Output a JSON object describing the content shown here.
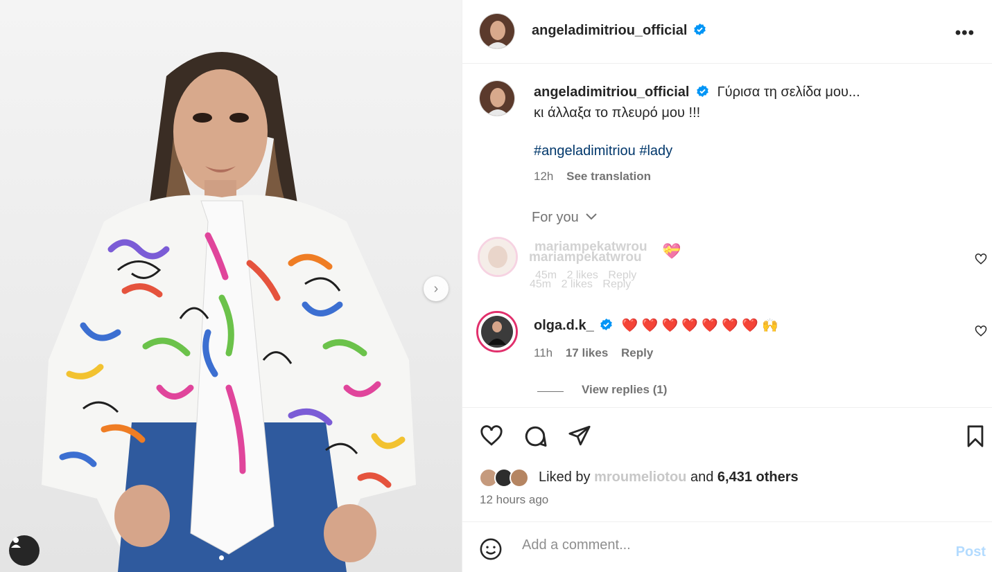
{
  "post": {
    "author": "angeladimitriou_official",
    "caption_line1": "Γύρισα τη σελίδα μου...",
    "caption_line2": "κι άλλαξα το πλευρό μου !!!",
    "hashtags": [
      "#angeladimitriou",
      "#lady"
    ],
    "posted_short": "12h",
    "see_translation": "See translation",
    "time_ago": "12 hours ago"
  },
  "comments_filter": "For you",
  "comments": [
    {
      "user": "mariampekatwrou",
      "time": "45m",
      "likes": "2 likes",
      "reply": "Reply"
    },
    {
      "user": "olga.d.k_",
      "text": "❤️ ❤️ ❤️ ❤️ ❤️ ❤️ ❤️ 🙌",
      "time": "11h",
      "likes": "17 likes",
      "reply": "Reply",
      "view_replies": "View replies (1)"
    }
  ],
  "likes": {
    "prefix": "Liked by",
    "liker": "mroumeliotou",
    "connector": "and",
    "others": "6,431 others"
  },
  "comment_box": {
    "placeholder": "Add a comment...",
    "post_label": "Post"
  },
  "icons": {
    "more": "more-options-icon",
    "like": "heart-icon",
    "comment": "comment-icon",
    "share": "share-icon",
    "save": "bookmark-icon",
    "emoji": "emoji-icon",
    "verified": "verified-badge-icon",
    "next": "chevron-right-icon",
    "tagged": "user-tag-icon"
  },
  "colors": {
    "verified": "#0095f6",
    "hashtag": "#00376b",
    "heart_red": "#e0245e",
    "post_disabled": "#b3dbff"
  }
}
